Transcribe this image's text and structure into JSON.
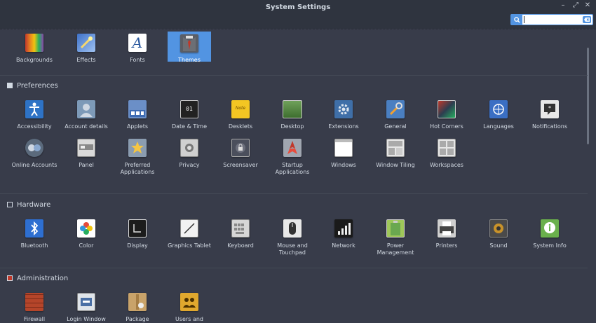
{
  "window": {
    "title": "System Settings"
  },
  "search": {
    "value": "",
    "placeholder": ""
  },
  "top_items": [
    {
      "label": "Backgrounds",
      "icon": "backgrounds-icon"
    },
    {
      "label": "Effects",
      "icon": "effects-icon"
    },
    {
      "label": "Fonts",
      "icon": "fonts-icon"
    },
    {
      "label": "Themes",
      "icon": "themes-icon",
      "selected": true
    }
  ],
  "sections": {
    "preferences": {
      "title": "Preferences",
      "items": [
        {
          "label": "Accessibility"
        },
        {
          "label": "Account details"
        },
        {
          "label": "Applets"
        },
        {
          "label": "Date & Time"
        },
        {
          "label": "Desklets"
        },
        {
          "label": "Desktop"
        },
        {
          "label": "Extensions"
        },
        {
          "label": "General"
        },
        {
          "label": "Hot Corners"
        },
        {
          "label": "Languages"
        },
        {
          "label": "Notifications"
        },
        {
          "label": "Online Accounts"
        },
        {
          "label": "Panel"
        },
        {
          "label": "Preferred Applications"
        },
        {
          "label": "Privacy"
        },
        {
          "label": "Screensaver"
        },
        {
          "label": "Startup Applications"
        },
        {
          "label": "Windows"
        },
        {
          "label": "Window Tiling"
        },
        {
          "label": "Workspaces"
        }
      ]
    },
    "hardware": {
      "title": "Hardware",
      "items": [
        {
          "label": "Bluetooth"
        },
        {
          "label": "Color"
        },
        {
          "label": "Display"
        },
        {
          "label": "Graphics Tablet"
        },
        {
          "label": "Keyboard"
        },
        {
          "label": "Mouse and Touchpad"
        },
        {
          "label": "Network"
        },
        {
          "label": "Power Management"
        },
        {
          "label": "Printers"
        },
        {
          "label": "Sound"
        },
        {
          "label": "System Info"
        }
      ]
    },
    "administration": {
      "title": "Administration",
      "items": [
        {
          "label": "Firewall"
        },
        {
          "label": "Login Window"
        },
        {
          "label": "Package"
        },
        {
          "label": "Users and"
        }
      ]
    }
  },
  "colors": {
    "bg": "#383c4a",
    "titlebar": "#2f343f",
    "accent": "#5294e2",
    "text": "#d3dae3"
  }
}
